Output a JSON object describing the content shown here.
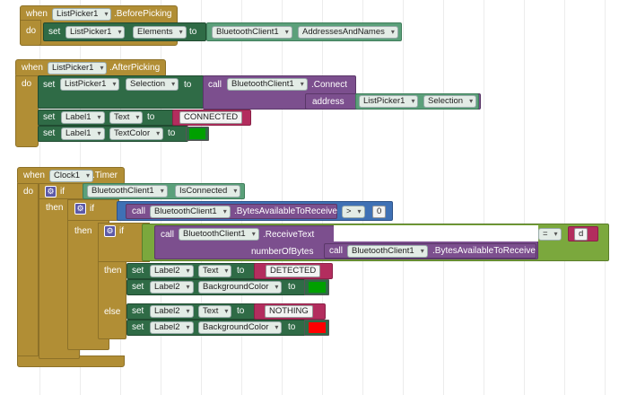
{
  "canvas": {
    "background": "#ffffff"
  },
  "colors": {
    "event": "#b18e35",
    "setter": "#2f6b46",
    "call": "#7c4f8e",
    "math": "#3f71b5",
    "logic": "#7ba83d",
    "text": "#b32d5e",
    "green_value": "#00a000",
    "red_value": "#ff0000"
  },
  "block1": {
    "when": "when",
    "component": "ListPicker1",
    "event": ".BeforePicking",
    "do": "do",
    "set": "set",
    "target": "ListPicker1",
    "property": "Elements",
    "to": "to",
    "source_component": "BluetoothClient1",
    "source_property": "AddressesAndNames"
  },
  "block2": {
    "when": "when",
    "component": "ListPicker1",
    "event": ".AfterPicking",
    "do": "do",
    "row1": {
      "set": "set",
      "component": "ListPicker1",
      "property": "Selection",
      "to": "to",
      "call": "call",
      "call_component": "BluetoothClient1",
      "method": ".Connect",
      "param": "address",
      "arg_component": "ListPicker1",
      "arg_property": "Selection"
    },
    "row2": {
      "set": "set",
      "component": "Label1",
      "property": "Text",
      "to": "to",
      "value": "CONNECTED"
    },
    "row3": {
      "set": "set",
      "component": "Label1",
      "property": "TextColor",
      "to": "to",
      "color_name": "green"
    }
  },
  "block3": {
    "when": "when",
    "component": "Clock1",
    "event": ".Timer",
    "do": "do",
    "if1": {
      "if": "if",
      "component": "BluetoothClient1",
      "property": "IsConnected"
    },
    "then1": "then",
    "if2": {
      "if": "if",
      "call": "call",
      "component": "BluetoothClient1",
      "method": ".BytesAvailableToReceive",
      "op": ">",
      "value": "0"
    },
    "then2": "then",
    "if3": {
      "if": "if",
      "call": "call",
      "component": "BluetoothClient1",
      "method": ".ReceiveText",
      "param": "numberOfBytes",
      "inner_call": "call",
      "inner_component": "BluetoothClient1",
      "inner_method": ".BytesAvailableToReceive",
      "op": "=",
      "value": "d"
    },
    "then3": "then",
    "then_row1": {
      "set": "set",
      "component": "Label2",
      "property": "Text",
      "to": "to",
      "value": "DETECTED"
    },
    "then_row2": {
      "set": "set",
      "component": "Label2",
      "property": "BackgroundColor",
      "to": "to",
      "color_name": "green"
    },
    "else": "else",
    "else_row1": {
      "set": "set",
      "component": "Label2",
      "property": "Text",
      "to": "to",
      "value": "NOTHING"
    },
    "else_row2": {
      "set": "set",
      "component": "Label2",
      "property": "BackgroundColor",
      "to": "to",
      "color_name": "red"
    }
  }
}
